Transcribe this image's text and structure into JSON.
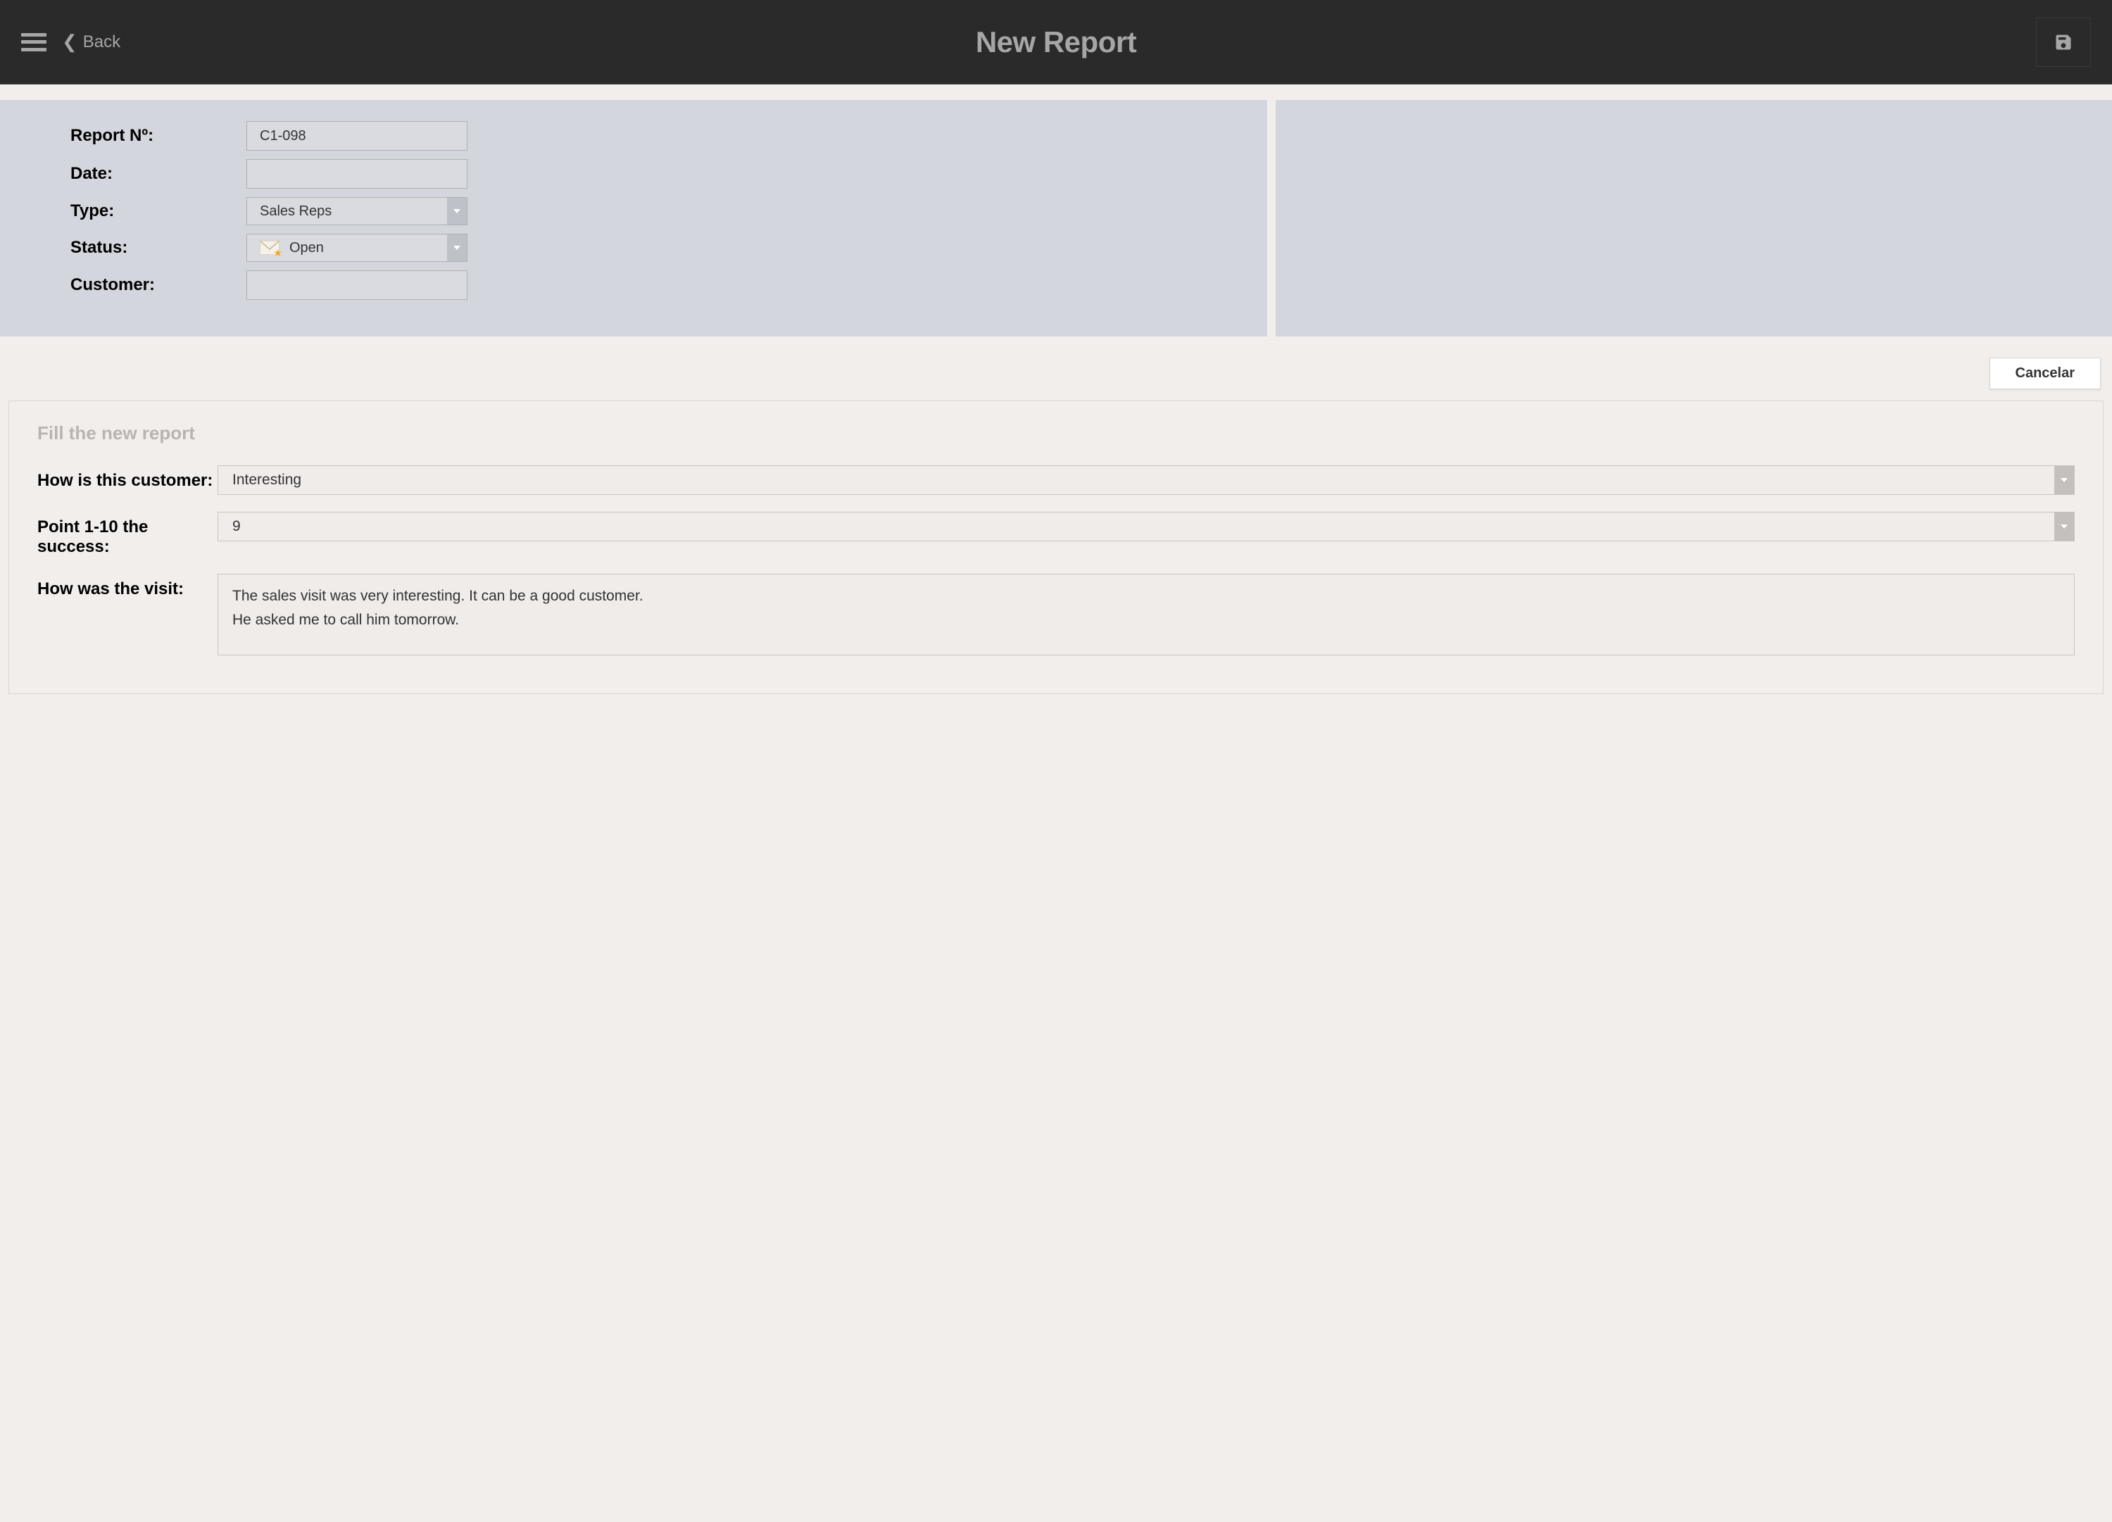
{
  "header": {
    "back_label": "Back",
    "title": "New Report"
  },
  "form": {
    "report_no_label": "Report Nº:",
    "report_no_value": "C1-098",
    "date_label": "Date:",
    "date_value": "",
    "type_label": "Type:",
    "type_value": "Sales Reps",
    "status_label": "Status:",
    "status_value": "Open",
    "customer_label": "Customer:",
    "customer_value": ""
  },
  "cancel_label": "Cancelar",
  "report": {
    "section_title": "Fill the new report",
    "q1_label": "How is this customer:",
    "q1_value": "Interesting",
    "q2_label": "Point 1-10 the success:",
    "q2_value": "9",
    "q3_label": "How was the visit:",
    "q3_value": "The sales visit was very interesting. It can be a good customer.\nHe asked me to call him tomorrow."
  }
}
